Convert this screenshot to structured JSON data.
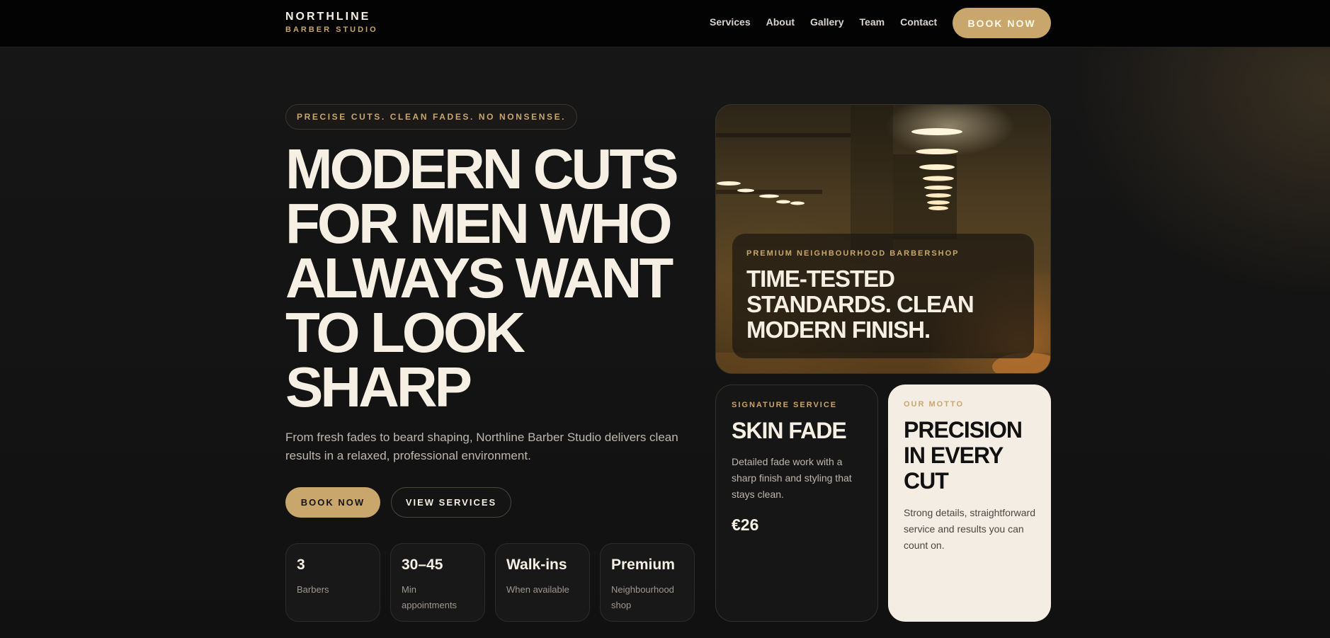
{
  "brand": {
    "name": "NORTHLINE",
    "subtitle": "BARBER STUDIO"
  },
  "nav": {
    "links": [
      "Services",
      "About",
      "Gallery",
      "Team",
      "Contact"
    ],
    "cta": "BOOK NOW"
  },
  "hero": {
    "tagline": "PRECISE CUTS. CLEAN FADES. NO NONSENSE.",
    "title_lines": [
      "MODERN CUTS",
      "FOR MEN WHO",
      "ALWAYS WANT",
      "TO LOOK",
      "SHARP"
    ],
    "description": "From fresh fades to beard shaping, Northline Barber Studio delivers clean results in a relaxed, professional environment.",
    "primary_button": "BOOK NOW",
    "secondary_button": "VIEW SERVICES",
    "stats": [
      {
        "value": "3",
        "label": "Barbers"
      },
      {
        "value": "30–45",
        "label": "Min appointments"
      },
      {
        "value": "Walk-ins",
        "label": "When available"
      },
      {
        "value": "Premium",
        "label": "Neighbourhood shop"
      }
    ]
  },
  "feature_image": {
    "kicker": "PREMIUM NEIGHBOURHOOD BARBERSHOP",
    "title_lines": [
      "TIME-TESTED",
      "STANDARDS. CLEAN",
      "MODERN FINISH."
    ]
  },
  "signature_card": {
    "kicker": "SIGNATURE SERVICE",
    "title": "SKIN FADE",
    "description": "Detailed fade work with a sharp finish and styling that stays clean.",
    "price": "€26"
  },
  "motto_card": {
    "kicker": "OUR MOTTO",
    "title_lines": [
      "PRECISION",
      "IN EVERY",
      "CUT"
    ],
    "description": "Strong details, straightforward service and results you can count on."
  },
  "colors": {
    "accent": "#c9a66b",
    "background": "#121212",
    "cream": "#f3ede3"
  }
}
